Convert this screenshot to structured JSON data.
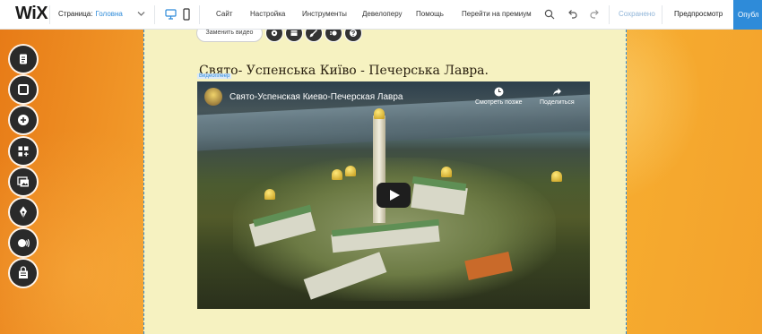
{
  "app": {
    "logo": "WiX"
  },
  "pages": {
    "label": "Страница:",
    "current": "Головна"
  },
  "menu": {
    "site": "Сайт",
    "settings": "Настройка",
    "tools": "Инструменты",
    "dev": "Девелоперу",
    "help": "Помощь",
    "premium": "Перейти на премиум",
    "status": "Сохранено",
    "preview": "Предпросмотр",
    "publish": "Опубл"
  },
  "icons": {
    "chevron": "chevron-down-icon",
    "desktop": "desktop-icon",
    "mobile": "mobile-icon",
    "zoom": "zoom-icon",
    "undo": "undo-icon",
    "redo": "redo-icon"
  },
  "actionbar": {
    "replace": "Заменить видео"
  },
  "editor": {
    "heading": "Свято- Успенська Київо - Печерська Лавра.",
    "element_tag": "Видеоплеер"
  },
  "video": {
    "title": "Свято-Успенская Киево-Печерская Лавра",
    "watch_later": "Смотреть позже",
    "share": "Поделиться"
  },
  "colors": {
    "accent": "#2e8bd9",
    "strip": "#f6f2c1",
    "tool": "#2a2a2a"
  }
}
